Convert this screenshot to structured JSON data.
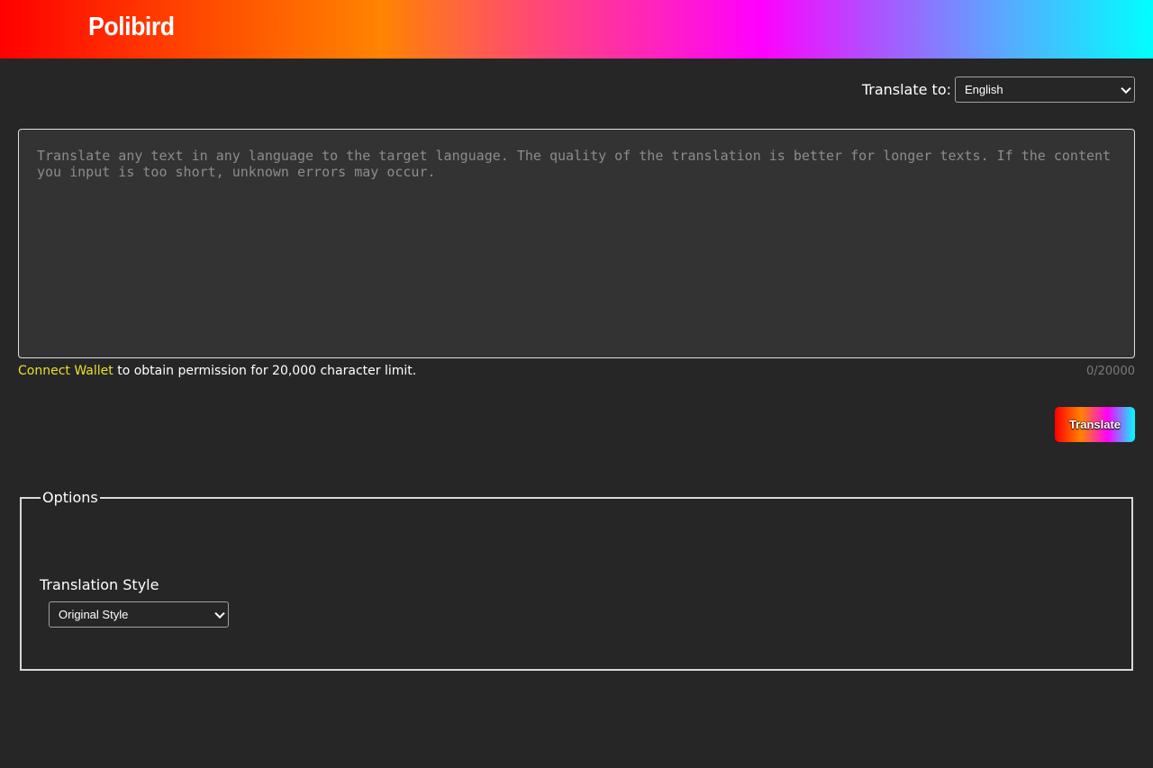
{
  "header": {
    "logo": "Polibird",
    "gradient": [
      "#ff0000",
      "#ff8400",
      "#ff00ff",
      "#00ffff"
    ]
  },
  "target_language": {
    "label": "Translate to:",
    "selected": "English"
  },
  "input": {
    "placeholder": "Translate any text in any language to the target language. The quality of the translation is better for longer texts. If the content you input is too short, unknown errors may occur.",
    "value": ""
  },
  "limit_note": {
    "link_text": "Connect Wallet",
    "rest_text": " to obtain permission for 20,000 character limit."
  },
  "char_count": "0/20000",
  "translate_button": {
    "label": "Translate"
  },
  "options": {
    "legend": "Options",
    "translation_style": {
      "label": "Translation Style",
      "selected": "Original Style"
    }
  },
  "colors": {
    "background": "#262626",
    "textarea_bg": "#333333",
    "link": "#e8e02a"
  }
}
